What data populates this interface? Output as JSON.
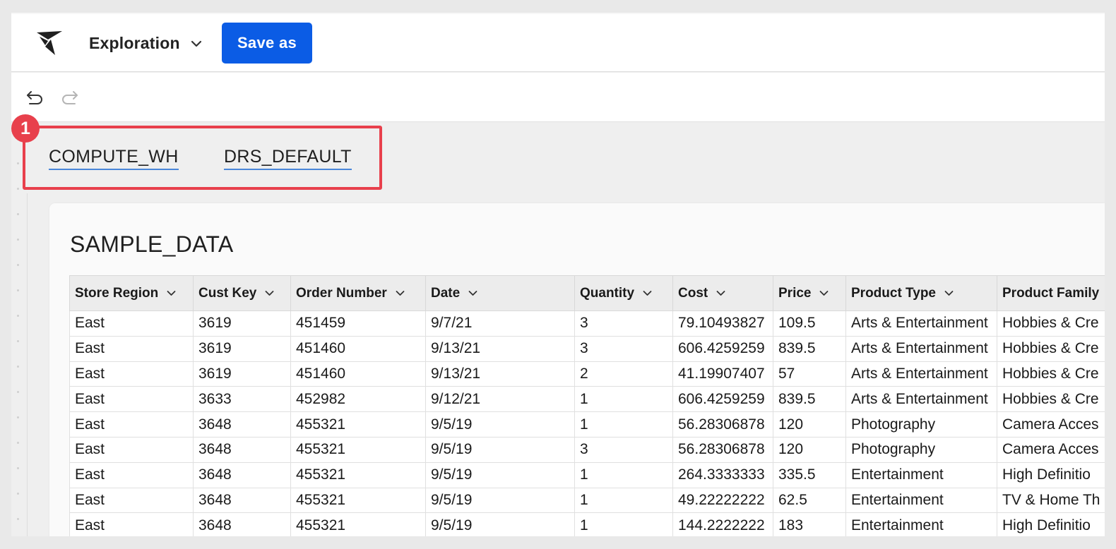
{
  "header": {
    "workbook_title": "Exploration",
    "save_label": "Save as"
  },
  "context": {
    "warehouse": "COMPUTE_WH",
    "role": "DRS_DEFAULT"
  },
  "annotation": {
    "step_number": "1",
    "highlight_color": "#e8404c"
  },
  "colors": {
    "primary_button": "#0b5ce5",
    "link_underline": "#4a86d9"
  },
  "table": {
    "title": "SAMPLE_DATA",
    "columns": [
      "Store Region",
      "Cust Key",
      "Order Number",
      "Date",
      "Quantity",
      "Cost",
      "Price",
      "Product Type",
      "Product Family"
    ],
    "rows": [
      [
        "East",
        "3619",
        "451459",
        "9/7/21",
        "3",
        "79.10493827",
        "109.5",
        "Arts & Entertainment",
        "Hobbies & Cre"
      ],
      [
        "East",
        "3619",
        "451460",
        "9/13/21",
        "3",
        "606.4259259",
        "839.5",
        "Arts & Entertainment",
        "Hobbies & Cre"
      ],
      [
        "East",
        "3619",
        "451460",
        "9/13/21",
        "2",
        "41.19907407",
        "57",
        "Arts & Entertainment",
        "Hobbies & Cre"
      ],
      [
        "East",
        "3633",
        "452982",
        "9/12/21",
        "1",
        "606.4259259",
        "839.5",
        "Arts & Entertainment",
        "Hobbies & Cre"
      ],
      [
        "East",
        "3648",
        "455321",
        "9/5/19",
        "1",
        "56.28306878",
        "120",
        "Photography",
        "Camera Acces"
      ],
      [
        "East",
        "3648",
        "455321",
        "9/5/19",
        "3",
        "56.28306878",
        "120",
        "Photography",
        "Camera Acces"
      ],
      [
        "East",
        "3648",
        "455321",
        "9/5/19",
        "1",
        "264.3333333",
        "335.5",
        "Entertainment",
        "High Definitio"
      ],
      [
        "East",
        "3648",
        "455321",
        "9/5/19",
        "1",
        "49.22222222",
        "62.5",
        "Entertainment",
        "TV & Home Th"
      ],
      [
        "East",
        "3648",
        "455321",
        "9/5/19",
        "1",
        "144.2222222",
        "183",
        "Entertainment",
        "High Definitio"
      ]
    ]
  }
}
